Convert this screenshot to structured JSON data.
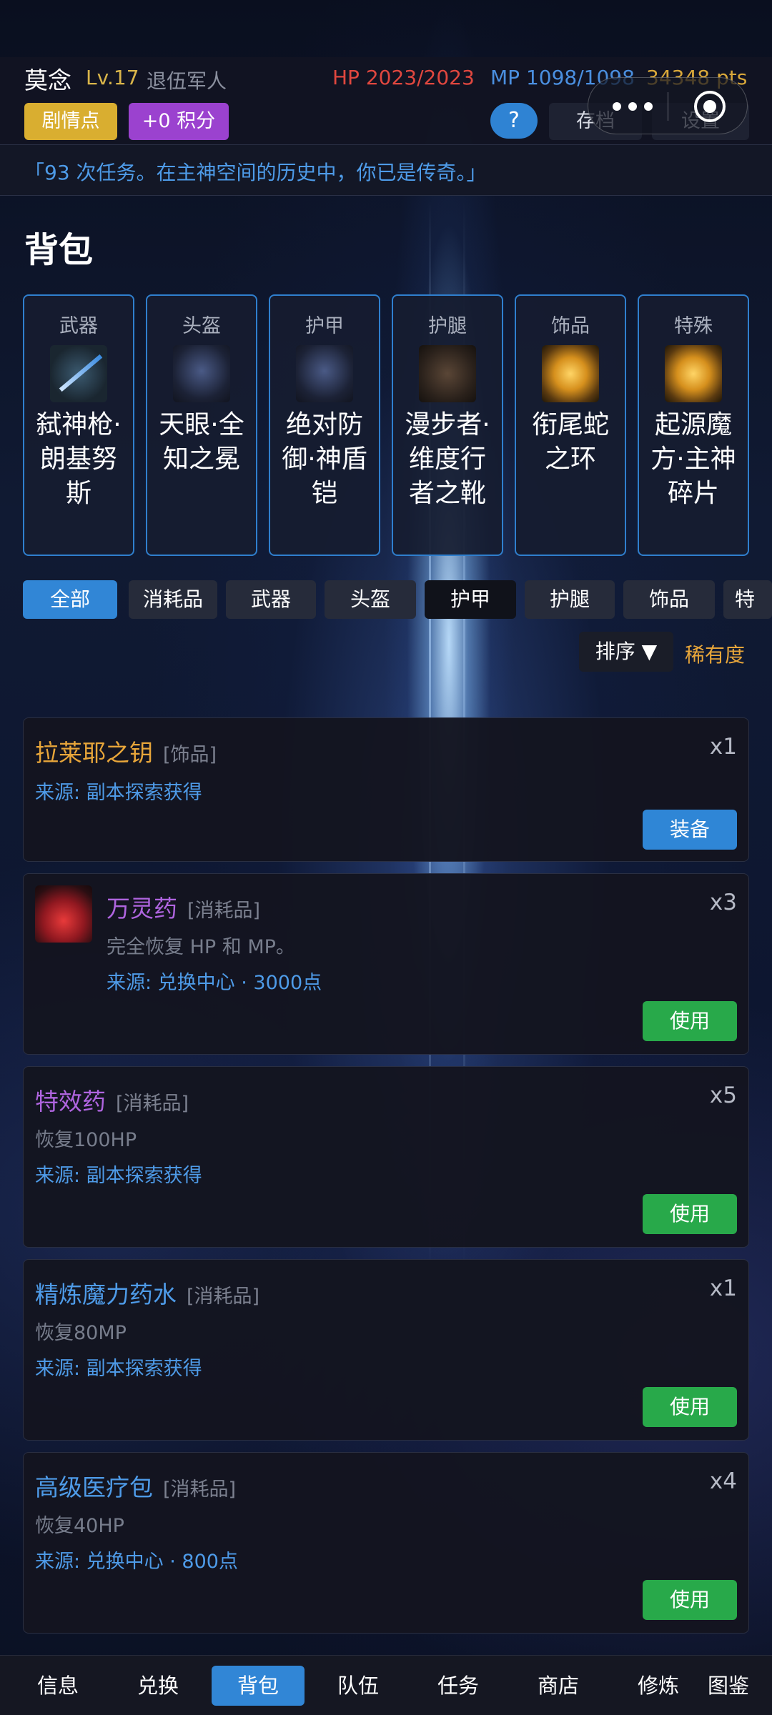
{
  "header": {
    "player_name": "莫念",
    "level": "Lv.17",
    "class_name": "退伍军人",
    "hp": "HP 2023/2023",
    "mp": "MP 1098/1098",
    "points": "34348 pts",
    "story_button": "剧情点",
    "points_button": "+0 积分",
    "help_button": "?",
    "save_button": "存档",
    "settings_button": "设置"
  },
  "quote": "「93 次任务。在主神空间的历史中，你已是传奇。」",
  "backpack": {
    "title": "背包",
    "slots": [
      {
        "label": "武器",
        "item": "弑神枪·朗基努斯",
        "icon": "spear-icon"
      },
      {
        "label": "头盔",
        "item": "天眼·全知之冕",
        "icon": "helmet-icon"
      },
      {
        "label": "护甲",
        "item": "绝对防御·神盾铠",
        "icon": "armor-icon"
      },
      {
        "label": "护腿",
        "item": "漫步者·维度行者之靴",
        "icon": "boots-icon"
      },
      {
        "label": "饰品",
        "item": "衔尾蛇之环",
        "icon": "ring-icon"
      },
      {
        "label": "特殊",
        "item": "起源魔方·主神碎片",
        "icon": "cube-icon"
      }
    ]
  },
  "filters": {
    "tabs": [
      "全部",
      "消耗品",
      "武器",
      "头盔",
      "护甲",
      "护腿",
      "饰品",
      "特殊"
    ],
    "active": "全部",
    "sort_label": "排序 ▼",
    "sort_value": "稀有度"
  },
  "items": [
    {
      "name": "拉莱耶之钥",
      "category": "[饰品]",
      "qty": "x1",
      "source": "来源: 副本探索获得",
      "action": "装备",
      "color": "#e8a63a"
    },
    {
      "name": "万灵药",
      "category": "[消耗品]",
      "qty": "x3",
      "desc": "完全恢复 HP 和 MP。",
      "source": "来源: 兑换中心 · 3000点",
      "action": "使用",
      "color": "#b065e0",
      "icon": "potion-icon"
    },
    {
      "name": "特效药",
      "category": "[消耗品]",
      "qty": "x5",
      "desc": "恢复100HP",
      "source": "来源: 副本探索获得",
      "action": "使用",
      "color": "#b065e0"
    },
    {
      "name": "精炼魔力药水",
      "category": "[消耗品]",
      "qty": "x1",
      "desc": "恢复80MP",
      "source": "来源: 副本探索获得",
      "action": "使用",
      "color": "#4e9be8"
    },
    {
      "name": "高级医疗包",
      "category": "[消耗品]",
      "qty": "x4",
      "desc": "恢复40HP",
      "source": "来源: 兑换中心 · 800点",
      "action": "使用",
      "color": "#4e9be8"
    }
  ],
  "bottom_nav": {
    "items": [
      "信息",
      "兑换",
      "背包",
      "队伍",
      "任务",
      "商店",
      "修炼",
      "图鉴"
    ],
    "active": "背包"
  },
  "colors": {
    "accent": "#3186d6",
    "use_button": "#28a94a",
    "hp": "#e0473f",
    "mp": "#4a8fe0",
    "gold": "#d9a83a"
  }
}
